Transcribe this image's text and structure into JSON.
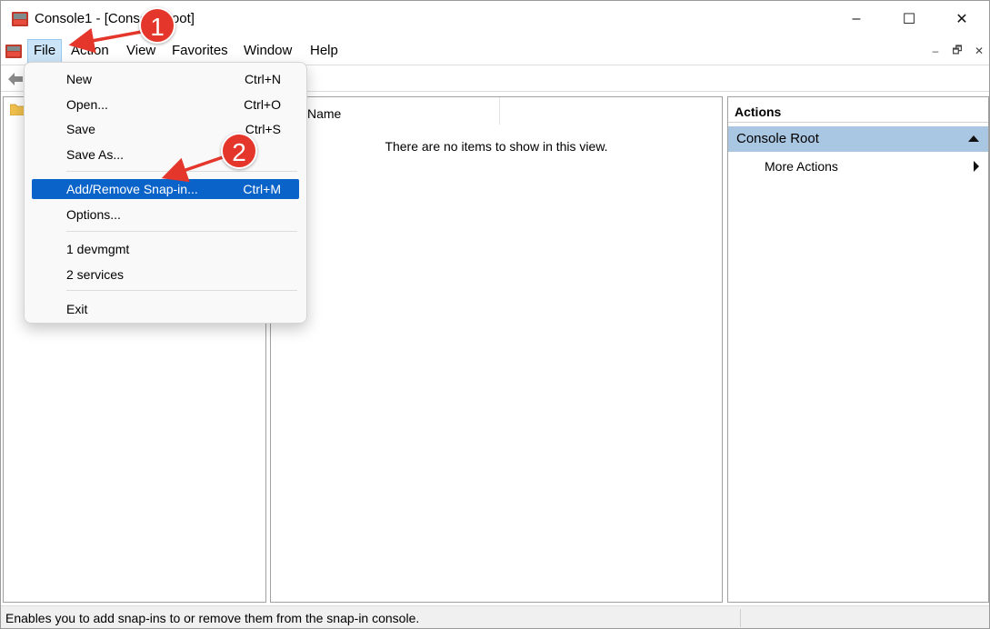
{
  "window": {
    "title": "Console1 - [Console Root]",
    "controls": {
      "minimize": "–",
      "maximize": "☐",
      "close": "✕"
    }
  },
  "menubar": {
    "items": [
      "File",
      "Action",
      "View",
      "Favorites",
      "Window",
      "Help"
    ],
    "mdi_controls": [
      "–",
      "🗗",
      "✕"
    ]
  },
  "file_menu": {
    "items": [
      {
        "label": "New",
        "shortcut": "Ctrl+N"
      },
      {
        "label": "Open...",
        "shortcut": "Ctrl+O"
      },
      {
        "label": "Save",
        "shortcut": "Ctrl+S"
      },
      {
        "label": "Save As...",
        "shortcut": ""
      },
      {
        "label": "Add/Remove Snap-in...",
        "shortcut": "Ctrl+M",
        "selected": true
      },
      {
        "label": "Options...",
        "shortcut": ""
      },
      {
        "label": "1 devmgmt",
        "shortcut": ""
      },
      {
        "label": "2 services",
        "shortcut": ""
      },
      {
        "label": "Exit",
        "shortcut": ""
      }
    ]
  },
  "center": {
    "column_header": "Name",
    "empty_message": "There are no items to show in this view."
  },
  "actions": {
    "title": "Actions",
    "group": "Console Root",
    "items": [
      "More Actions"
    ]
  },
  "status": {
    "text": "Enables you to add snap-ins to or remove them from the snap-in console."
  },
  "annotations": {
    "badge1": "1",
    "badge2": "2",
    "color": "#e5362b"
  },
  "colors": {
    "selection": "#0a63c9",
    "actions_header": "#a9c6e2",
    "menu_hover": "#cce4f7"
  }
}
